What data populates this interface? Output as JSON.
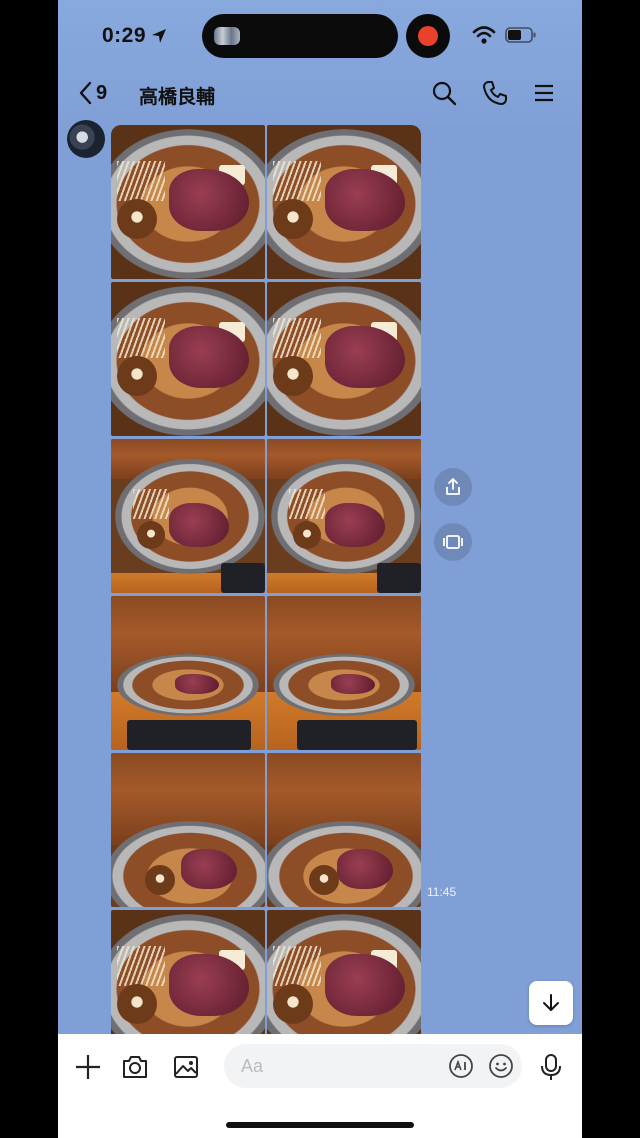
{
  "status_bar": {
    "time": "0:29"
  },
  "header": {
    "back_count": "9",
    "title": "高橋良輔"
  },
  "message": {
    "photos": [
      {
        "scene": "closeup"
      },
      {
        "scene": "closeup"
      },
      {
        "scene": "closeup"
      },
      {
        "scene": "closeup"
      },
      {
        "scene": "mid"
      },
      {
        "scene": "mid"
      },
      {
        "scene": "far"
      },
      {
        "scene": "far"
      },
      {
        "scene": "steam"
      },
      {
        "scene": "steam"
      },
      {
        "scene": "closeup"
      },
      {
        "scene": "closeup"
      }
    ],
    "timestamp": "11:45"
  },
  "composer": {
    "placeholder": "Aa"
  },
  "colors": {
    "chat_background": "#7f9fd6",
    "record_dot": "#e9412c"
  }
}
